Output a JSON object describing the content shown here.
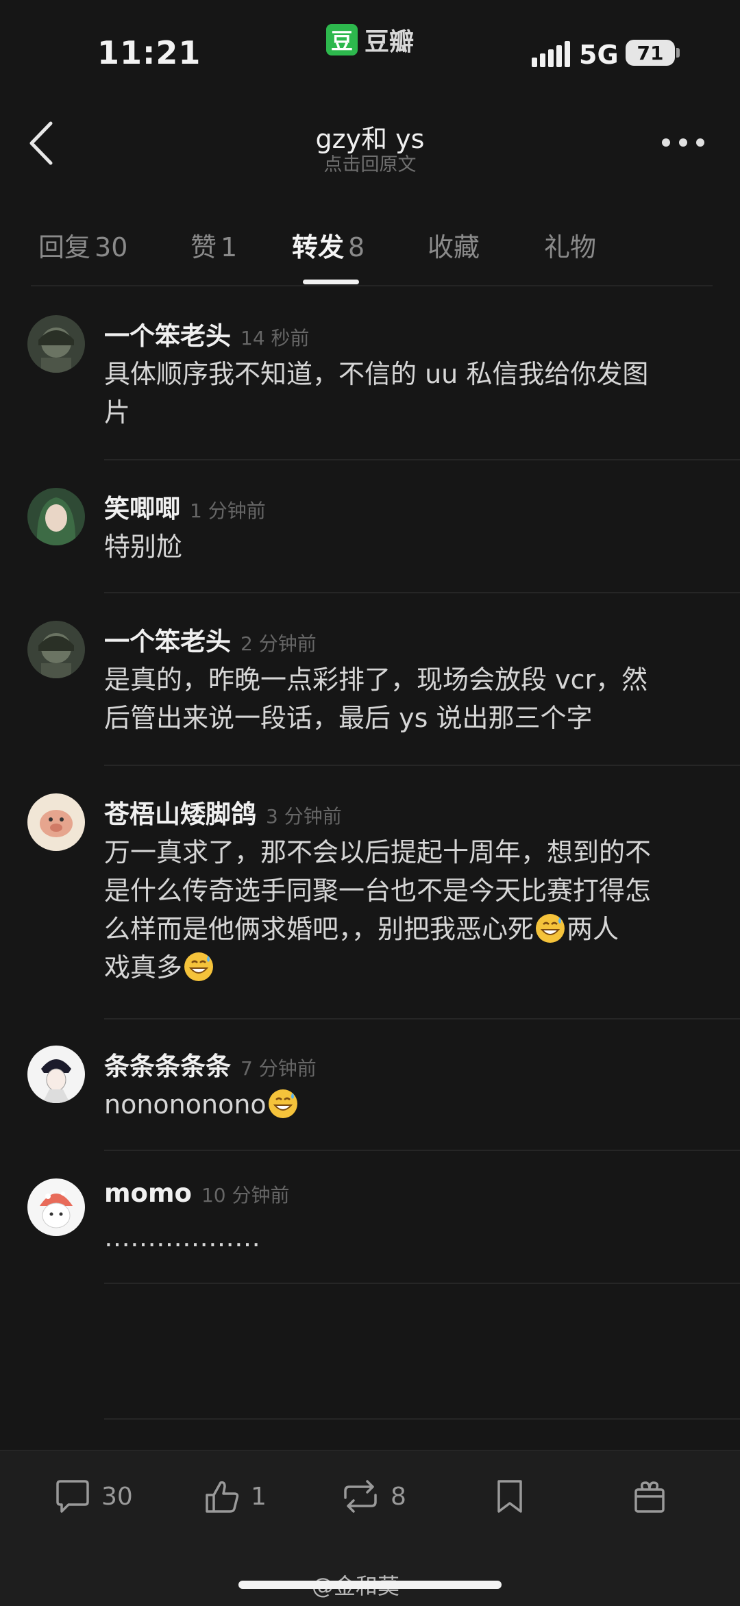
{
  "status": {
    "time": "11:21",
    "network": "5G",
    "battery": "71",
    "app_logo": "豆",
    "app_name": "豆瓣"
  },
  "header": {
    "title": "gzy和 ys",
    "subtitle": "点击回原文"
  },
  "tabs": [
    {
      "label": "回复",
      "count": "30"
    },
    {
      "label": "赞",
      "count": "1"
    },
    {
      "label": "转发",
      "count": "8"
    },
    {
      "label": "收藏",
      "count": ""
    },
    {
      "label": "礼物",
      "count": ""
    }
  ],
  "comments": [
    {
      "user": "一个笨老头",
      "time": "14 秒前",
      "lines": [
        "具体顺序我不知道，不信的 uu 私信我给你发图",
        "片"
      ]
    },
    {
      "user": "笑唧唧",
      "time": "1 分钟前",
      "lines": [
        "特别尬"
      ]
    },
    {
      "user": "一个笨老头",
      "time": "2 分钟前",
      "lines": [
        "是真的，昨晚一点彩排了，现场会放段 vcr，然",
        "后管出来说一段话，最后 ys 说出那三个字"
      ]
    },
    {
      "user": "苍梧山矮脚鸽",
      "time": "3 分钟前",
      "lines": [
        "万一真求了，那不会以后提起十周年，想到的不",
        "是什么传奇选手同聚一台也不是今天比赛打得怎",
        "么样而是他俩求婚吧，，别把我恶心死",
        "两人",
        "戏真多"
      ]
    },
    {
      "user": "条条条条条",
      "time": "7 分钟前",
      "lines": [
        "nonononono"
      ]
    },
    {
      "user": "momo",
      "time": "10 分钟前",
      "lines": [
        "………………"
      ]
    }
  ],
  "bottom_bar": {
    "reply_count": "30",
    "like_count": "1",
    "repost_count": "8"
  },
  "watermark": "@金和莫",
  "colors": {
    "background": "#161616",
    "accent": "#2db84d",
    "text": "#e8e8e8",
    "muted": "#6f6f6f"
  },
  "icons": [
    "back-arrow-icon",
    "more-dots-icon",
    "signal-icon",
    "battery-icon",
    "comment-icon",
    "like-icon",
    "repost-icon",
    "bookmark-icon",
    "gift-icon",
    "sweat-smile-emoji"
  ]
}
